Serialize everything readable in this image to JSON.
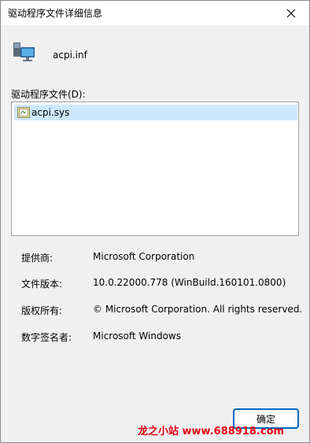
{
  "window": {
    "title": "驱动程序文件详细信息",
    "close_icon": "close-icon"
  },
  "header": {
    "icon": "device-monitor-icon",
    "filename": "acpi.inf"
  },
  "files": {
    "label": "驱动程序文件(D):",
    "items": [
      {
        "icon": "driver-file-icon",
        "name": "acpi.sys",
        "selected": true
      }
    ]
  },
  "details": {
    "provider_label": "提供商:",
    "provider_value": "Microsoft Corporation",
    "version_label": "文件版本:",
    "version_value": "10.0.22000.778 (WinBuild.160101.0800)",
    "copyright_label": "版权所有:",
    "copyright_value": "© Microsoft Corporation. All rights reserved.",
    "signer_label": "数字签名者:",
    "signer_value": "Microsoft Windows"
  },
  "buttons": {
    "ok_label": "确定"
  },
  "watermark": {
    "text": "龙之小站 www.688918.com"
  },
  "colors": {
    "selection": "#cde8ff",
    "accent": "#0067c0",
    "watermark": "#e60012"
  }
}
